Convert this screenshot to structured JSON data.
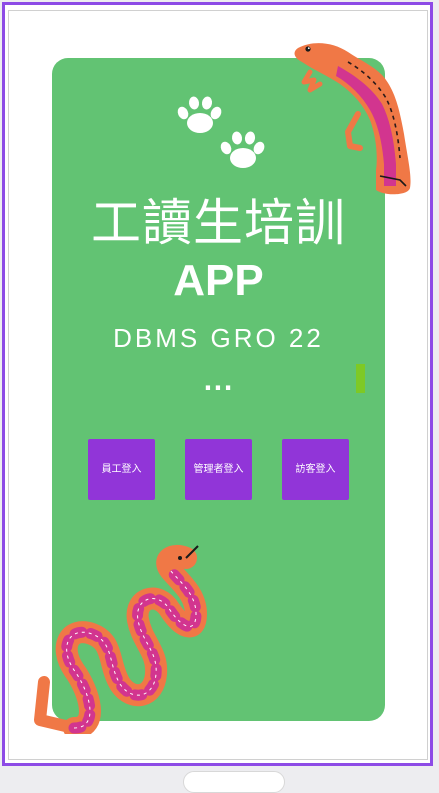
{
  "app": {
    "title_line1": "工讀生培訓",
    "title_line2": "APP",
    "subtitle": "DBMS GRO 22",
    "ellipsis": "..."
  },
  "buttons": {
    "employee_login": "員工登入",
    "admin_login": "管理者登入",
    "guest_login": "訪客登入"
  },
  "colors": {
    "card": "#62c373",
    "button": "#9135d8",
    "frame": "#8d4be6",
    "lizard": "#f07846",
    "lizard_belly": "#d2358f",
    "snake": "#f07846",
    "snake_spots": "#d2358f",
    "side_mark": "#7ec925"
  },
  "icons": [
    "paw-print-icon",
    "lizard-illustration",
    "snake-illustration"
  ]
}
